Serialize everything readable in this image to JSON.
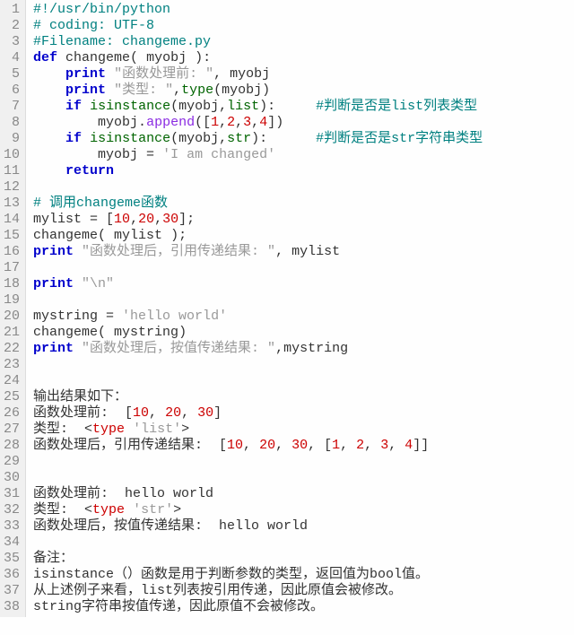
{
  "lines": {
    "l1": [
      [
        "cmt",
        "#!/usr/bin/python"
      ]
    ],
    "l2": [
      [
        "cmt",
        "# coding: UTF-8"
      ]
    ],
    "l3": [
      [
        "cmt",
        "#Filename: changeme.py"
      ]
    ],
    "l4": [
      [
        "kw",
        "def"
      ],
      [
        "id",
        " changeme"
      ],
      [
        "op",
        "("
      ],
      [
        "id",
        " myobj "
      ],
      [
        "op",
        "):"
      ]
    ],
    "l5": [
      [
        "id",
        "    "
      ],
      [
        "kw",
        "print"
      ],
      [
        "id",
        " "
      ],
      [
        "str",
        "\"函数处理前: \""
      ],
      [
        "op",
        ", "
      ],
      [
        "id",
        "myobj"
      ]
    ],
    "l6": [
      [
        "id",
        "    "
      ],
      [
        "kw",
        "print"
      ],
      [
        "id",
        " "
      ],
      [
        "str",
        "\"类型: \""
      ],
      [
        "op",
        ","
      ],
      [
        "builtin",
        "type"
      ],
      [
        "op",
        "("
      ],
      [
        "id",
        "myobj"
      ],
      [
        "op",
        ")"
      ]
    ],
    "l7": [
      [
        "id",
        "    "
      ],
      [
        "kw",
        "if"
      ],
      [
        "id",
        " "
      ],
      [
        "builtin",
        "isinstance"
      ],
      [
        "op",
        "("
      ],
      [
        "id",
        "myobj"
      ],
      [
        "op",
        ","
      ],
      [
        "builtin",
        "list"
      ],
      [
        "op",
        "):"
      ],
      [
        "id",
        "     "
      ],
      [
        "cmt",
        "#判断是否是list列表类型"
      ]
    ],
    "l8": [
      [
        "id",
        "        myobj"
      ],
      [
        "op",
        "."
      ],
      [
        "fn",
        "append"
      ],
      [
        "op",
        "(["
      ],
      [
        "num",
        "1"
      ],
      [
        "op",
        ","
      ],
      [
        "num",
        "2"
      ],
      [
        "op",
        ","
      ],
      [
        "num",
        "3"
      ],
      [
        "op",
        ","
      ],
      [
        "num",
        "4"
      ],
      [
        "op",
        "])"
      ]
    ],
    "l9": [
      [
        "id",
        "    "
      ],
      [
        "kw",
        "if"
      ],
      [
        "id",
        " "
      ],
      [
        "builtin",
        "isinstance"
      ],
      [
        "op",
        "("
      ],
      [
        "id",
        "myobj"
      ],
      [
        "op",
        ","
      ],
      [
        "builtin",
        "str"
      ],
      [
        "op",
        "):"
      ],
      [
        "id",
        "      "
      ],
      [
        "cmt",
        "#判断是否是str字符串类型"
      ]
    ],
    "l10": [
      [
        "id",
        "        myobj "
      ],
      [
        "op",
        "="
      ],
      [
        "id",
        " "
      ],
      [
        "str",
        "'I am changed'"
      ]
    ],
    "l11": [
      [
        "id",
        "    "
      ],
      [
        "kw",
        "return"
      ]
    ],
    "l12": [
      [
        "id",
        ""
      ]
    ],
    "l13": [
      [
        "cmt",
        "# 调用changeme函数"
      ]
    ],
    "l14": [
      [
        "id",
        "mylist "
      ],
      [
        "op",
        "= ["
      ],
      [
        "num",
        "10"
      ],
      [
        "op",
        ","
      ],
      [
        "num",
        "20"
      ],
      [
        "op",
        ","
      ],
      [
        "num",
        "30"
      ],
      [
        "op",
        "];"
      ]
    ],
    "l15": [
      [
        "id",
        "changeme"
      ],
      [
        "op",
        "("
      ],
      [
        "id",
        " mylist "
      ],
      [
        "op",
        ");"
      ]
    ],
    "l16": [
      [
        "kw",
        "print"
      ],
      [
        "id",
        " "
      ],
      [
        "str",
        "\"函数处理后，引用传递结果: \""
      ],
      [
        "op",
        ", "
      ],
      [
        "id",
        "mylist"
      ]
    ],
    "l17": [
      [
        "id",
        ""
      ]
    ],
    "l18": [
      [
        "kw",
        "print"
      ],
      [
        "id",
        " "
      ],
      [
        "str",
        "\"\\n\""
      ]
    ],
    "l19": [
      [
        "id",
        ""
      ]
    ],
    "l20": [
      [
        "id",
        "mystring "
      ],
      [
        "op",
        "= "
      ],
      [
        "str",
        "'hello world'"
      ]
    ],
    "l21": [
      [
        "id",
        "changeme"
      ],
      [
        "op",
        "("
      ],
      [
        "id",
        " mystring"
      ],
      [
        "op",
        ")"
      ]
    ],
    "l22": [
      [
        "kw",
        "print"
      ],
      [
        "id",
        " "
      ],
      [
        "str",
        "\"函数处理后，按值传递结果: \""
      ],
      [
        "op",
        ","
      ],
      [
        "id",
        "mystring"
      ]
    ],
    "l23": [
      [
        "id",
        ""
      ]
    ],
    "l24": [
      [
        "id",
        ""
      ]
    ],
    "l25": [
      [
        "id",
        "输出结果如下："
      ]
    ],
    "l26": [
      [
        "id",
        "函数处理前:  ["
      ],
      [
        "out-num",
        "10"
      ],
      [
        "id",
        ", "
      ],
      [
        "out-num",
        "20"
      ],
      [
        "id",
        ", "
      ],
      [
        "out-num",
        "30"
      ],
      [
        "id",
        "]"
      ]
    ],
    "l27": [
      [
        "id",
        "类型:  <"
      ],
      [
        "out-type",
        "type"
      ],
      [
        "id",
        " "
      ],
      [
        "str",
        "'list'"
      ],
      [
        "id",
        ">"
      ]
    ],
    "l28": [
      [
        "id",
        "函数处理后，引用传递结果:  ["
      ],
      [
        "out-num",
        "10"
      ],
      [
        "id",
        ", "
      ],
      [
        "out-num",
        "20"
      ],
      [
        "id",
        ", "
      ],
      [
        "out-num",
        "30"
      ],
      [
        "id",
        ", ["
      ],
      [
        "out-num",
        "1"
      ],
      [
        "id",
        ", "
      ],
      [
        "out-num",
        "2"
      ],
      [
        "id",
        ", "
      ],
      [
        "out-num",
        "3"
      ],
      [
        "id",
        ", "
      ],
      [
        "out-num",
        "4"
      ],
      [
        "id",
        "]]"
      ]
    ],
    "l29": [
      [
        "id",
        ""
      ]
    ],
    "l30": [
      [
        "id",
        ""
      ]
    ],
    "l31": [
      [
        "id",
        "函数处理前:  hello world"
      ]
    ],
    "l32": [
      [
        "id",
        "类型:  <"
      ],
      [
        "out-type",
        "type"
      ],
      [
        "id",
        " "
      ],
      [
        "str",
        "'str'"
      ],
      [
        "id",
        ">"
      ]
    ],
    "l33": [
      [
        "id",
        "函数处理后，按值传递结果:  hello world"
      ]
    ],
    "l34": [
      [
        "id",
        ""
      ]
    ],
    "l35": [
      [
        "id",
        "备注："
      ]
    ],
    "l36": [
      [
        "id",
        "isinstance（）函数是用于判断参数的类型，返回值为bool值。"
      ]
    ],
    "l37": [
      [
        "id",
        "从上述例子来看，list列表按引用传递，因此原值会被修改。"
      ]
    ],
    "l38": [
      [
        "id",
        "string字符串按值传递，因此原值不会被修改。"
      ]
    ]
  },
  "lineCount": 38
}
